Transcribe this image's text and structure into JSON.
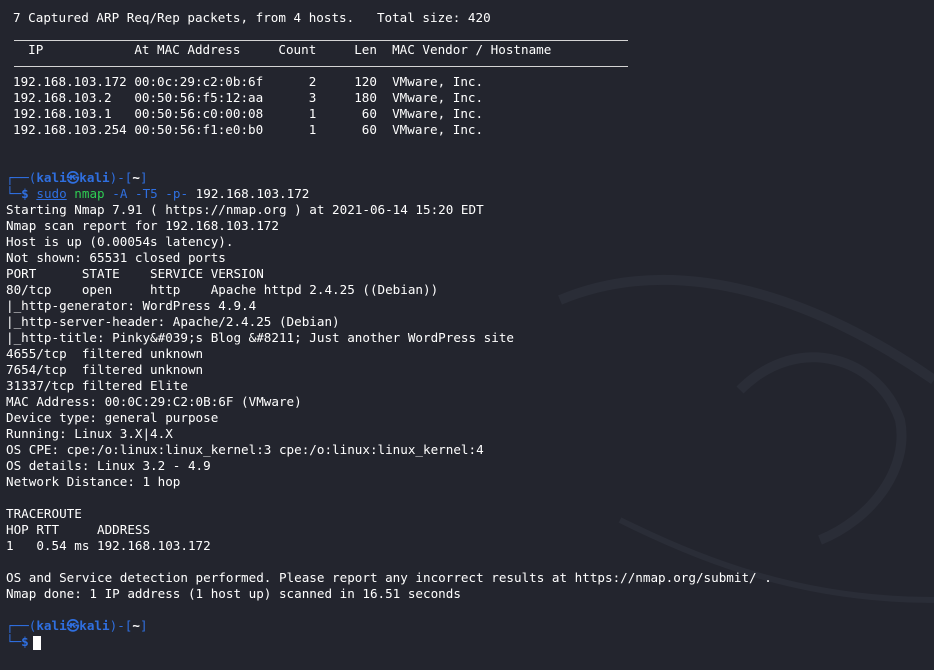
{
  "arp_header": "7 Captured ARP Req/Rep packets, from 4 hosts.   Total size: 420",
  "arp_columns": "  IP            At MAC Address     Count     Len  MAC Vendor / Hostname",
  "arp_rows": [
    "192.168.103.172 00:0c:29:c2:0b:6f      2     120  VMware, Inc.",
    "192.168.103.2   00:50:56:f5:12:aa      3     180  VMware, Inc.",
    "192.168.103.1   00:50:56:c0:00:08      1      60  VMware, Inc.",
    "192.168.103.254 00:50:56:f1:e0:b0      1      60  VMware, Inc."
  ],
  "prompt": {
    "corner_top": "┌──(",
    "user": "kali㉿kali",
    "cwd_prefix": ")-[",
    "cwd": "~",
    "cwd_suffix": "]",
    "corner_bottom": "└─",
    "dollar": "$"
  },
  "command": {
    "sudo": "sudo",
    "nmap": "nmap",
    "flags": "-A -T5 -p-",
    "target": "192.168.103.172"
  },
  "nmap_output": [
    "Starting Nmap 7.91 ( https://nmap.org ) at 2021-06-14 15:20 EDT",
    "Nmap scan report for 192.168.103.172",
    "Host is up (0.00054s latency).",
    "Not shown: 65531 closed ports",
    "PORT      STATE    SERVICE VERSION",
    "80/tcp    open     http    Apache httpd 2.4.25 ((Debian))",
    "|_http-generator: WordPress 4.9.4",
    "|_http-server-header: Apache/2.4.25 (Debian)",
    "|_http-title: Pinky&#039;s Blog &#8211; Just another WordPress site",
    "4655/tcp  filtered unknown",
    "7654/tcp  filtered unknown",
    "31337/tcp filtered Elite",
    "MAC Address: 00:0C:29:C2:0B:6F (VMware)",
    "Device type: general purpose",
    "Running: Linux 3.X|4.X",
    "OS CPE: cpe:/o:linux:linux_kernel:3 cpe:/o:linux:linux_kernel:4",
    "OS details: Linux 3.2 - 4.9",
    "Network Distance: 1 hop",
    "",
    "TRACEROUTE",
    "HOP RTT     ADDRESS",
    "1   0.54 ms 192.168.103.172",
    "",
    "OS and Service detection performed. Please report any incorrect results at https://nmap.org/submit/ .",
    "Nmap done: 1 IP address (1 host up) scanned in 16.51 seconds"
  ],
  "colors": {
    "background": "#23252e",
    "prompt_blue": "#2f6fe0",
    "command_green": "#2ecc52",
    "text": "#ffffff"
  }
}
